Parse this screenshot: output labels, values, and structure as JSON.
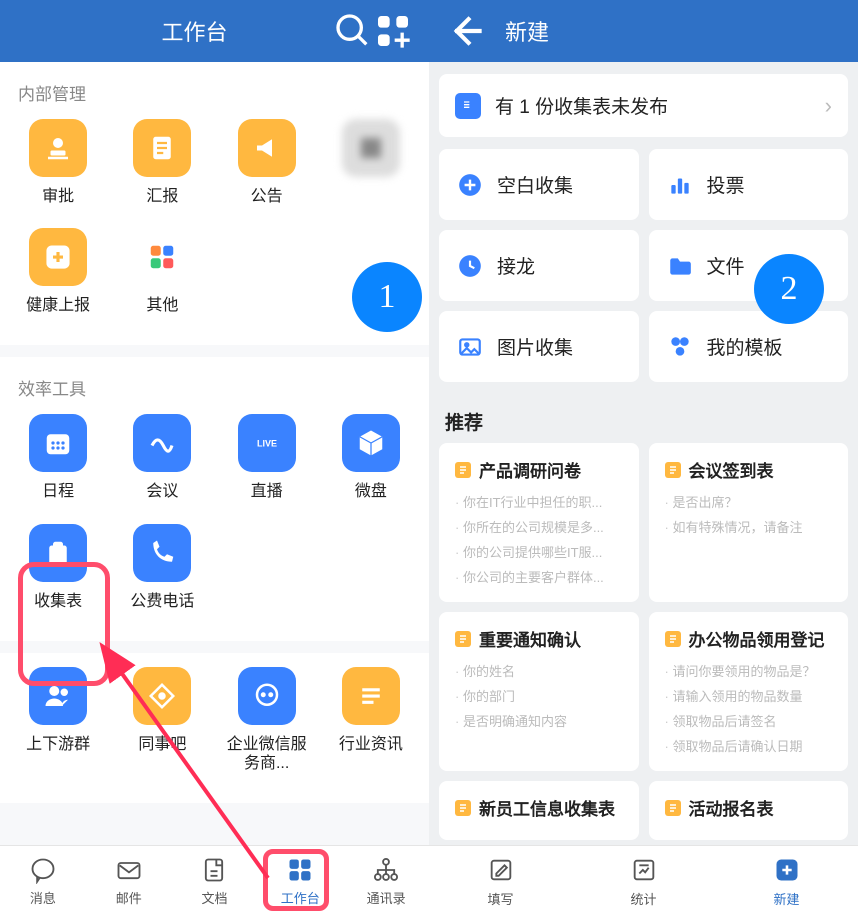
{
  "left": {
    "header_title": "工作台",
    "sections": [
      {
        "title": "内部管理",
        "items": [
          {
            "name": "approval",
            "label": "审批",
            "color": "#ffb840",
            "icon": "stamp"
          },
          {
            "name": "report",
            "label": "汇报",
            "color": "#ffb840",
            "icon": "doc"
          },
          {
            "name": "announce",
            "label": "公告",
            "color": "#ffb840",
            "icon": "horn"
          },
          {
            "name": "blurred1",
            "label": "",
            "blurred": true
          },
          {
            "name": "health",
            "label": "健康上报",
            "color": "#ffb840",
            "icon": "plus"
          },
          {
            "name": "other",
            "label": "其他",
            "color": "multi",
            "icon": "grid4"
          }
        ]
      },
      {
        "title": "效率工具",
        "items": [
          {
            "name": "calendar",
            "label": "日程",
            "color": "#3a82ff",
            "icon": "cal"
          },
          {
            "name": "meeting",
            "label": "会议",
            "color": "#3a82ff",
            "icon": "wave"
          },
          {
            "name": "live",
            "label": "直播",
            "color": "#3a82ff",
            "icon": "live"
          },
          {
            "name": "weipan",
            "label": "微盘",
            "color": "#3a82ff",
            "icon": "box"
          },
          {
            "name": "form",
            "label": "收集表",
            "color": "#3a82ff",
            "icon": "clip"
          },
          {
            "name": "phone",
            "label": "公费电话",
            "color": "#3a82ff",
            "icon": "phone"
          }
        ]
      },
      {
        "title": "",
        "items": [
          {
            "name": "upstream",
            "label": "上下游群",
            "color": "#3a82ff",
            "icon": "people"
          },
          {
            "name": "colleague",
            "label": "同事吧",
            "color": "#ffb840",
            "icon": "diamond"
          },
          {
            "name": "wxwork",
            "label": "企业微信服务商...",
            "color": "#3a82ff",
            "icon": "chat"
          },
          {
            "name": "news",
            "label": "行业资讯",
            "color": "#ffb840",
            "icon": "lines"
          }
        ]
      }
    ],
    "tabs": [
      {
        "name": "messages",
        "label": "消息",
        "icon": "bubble"
      },
      {
        "name": "mail",
        "label": "邮件",
        "icon": "mail"
      },
      {
        "name": "docs",
        "label": "文档",
        "icon": "docs"
      },
      {
        "name": "workbench",
        "label": "工作台",
        "icon": "grid4b",
        "active": true
      },
      {
        "name": "contacts",
        "label": "通讯录",
        "icon": "org"
      }
    ],
    "badge": "1"
  },
  "right": {
    "header_title": "新建",
    "notice": "有 1 份收集表未发布",
    "options": [
      {
        "name": "blank",
        "label": "空白收集",
        "icon": "plus-circle",
        "color": "#3a82ff"
      },
      {
        "name": "vote",
        "label": "投票",
        "icon": "bars",
        "color": "#3a82ff"
      },
      {
        "name": "chain",
        "label": "接龙",
        "icon": "clock",
        "color": "#3a82ff"
      },
      {
        "name": "file",
        "label": "文件",
        "icon": "folder",
        "color": "#3a82ff"
      },
      {
        "name": "image",
        "label": "图片收集",
        "icon": "image",
        "color": "#3a82ff"
      },
      {
        "name": "template",
        "label": "我的模板",
        "icon": "shapes",
        "color": "#3a82ff"
      }
    ],
    "rec_title": "推荐",
    "rec": [
      {
        "name": "survey",
        "title": "产品调研问卷",
        "items": [
          "你在IT行业中担任的职...",
          "你所在的公司规模是多...",
          "你的公司提供哪些IT服...",
          "你公司的主要客户群体..."
        ]
      },
      {
        "name": "signin",
        "title": "会议签到表",
        "items": [
          "是否出席？",
          "如有特殊情况，请备注"
        ]
      },
      {
        "name": "confirm",
        "title": "重要通知确认",
        "items": [
          "你的姓名",
          "你的部门",
          "是否明确通知内容"
        ]
      },
      {
        "name": "supply",
        "title": "办公物品领用登记",
        "items": [
          "请问你要领用的物品是？",
          "请输入领用的物品数量",
          "领取物品后请签名",
          "领取物品后请确认日期"
        ]
      },
      {
        "name": "newemp",
        "title": "新员工信息收集表",
        "items": []
      },
      {
        "name": "event",
        "title": "活动报名表",
        "items": []
      }
    ],
    "tabs": [
      {
        "name": "write",
        "label": "填写",
        "icon": "pencil"
      },
      {
        "name": "stats",
        "label": "统计",
        "icon": "chart"
      },
      {
        "name": "new",
        "label": "新建",
        "icon": "plus-sq",
        "active": true
      }
    ],
    "badge": "2"
  }
}
